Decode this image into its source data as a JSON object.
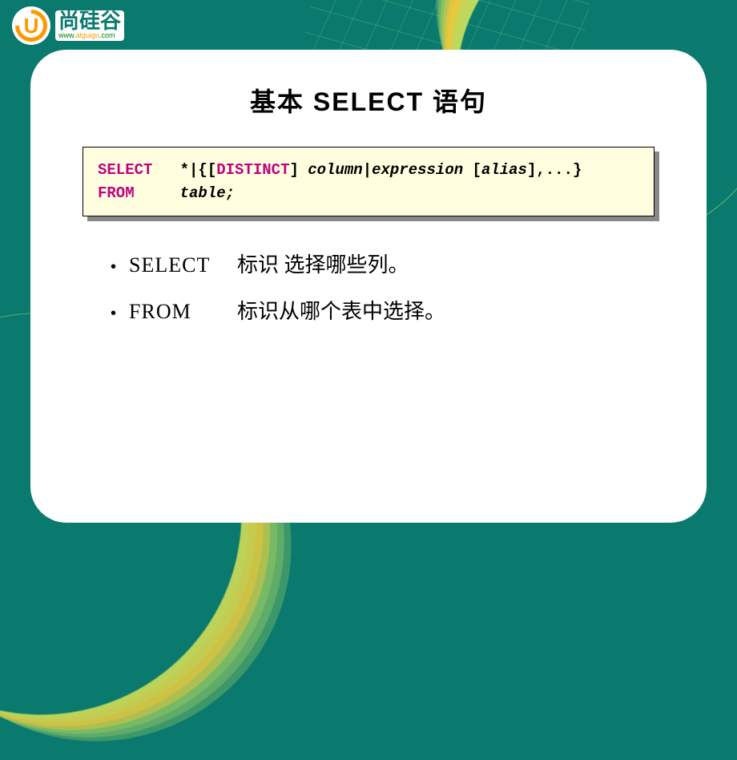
{
  "logo": {
    "icon_letter": "U",
    "brand_text": "尚硅谷",
    "url_www": "www.",
    "url_mid": "atguigu",
    "url_com": ".com"
  },
  "slide": {
    "title": "基本 SELECT 语句",
    "code": {
      "line1_select": "SELECT",
      "line1_star": "   *|{[",
      "line1_distinct": "DISTINCT",
      "line1_rest_a": "] ",
      "line1_column": "column",
      "line1_pipe": "|",
      "line1_expression": "expression",
      "line1_space": " [",
      "line1_alias": "alias",
      "line1_end": "],...}",
      "line2_from": "FROM",
      "line2_pad": "     ",
      "line2_table": "table;"
    },
    "bullets": [
      {
        "keyword": "SELECT",
        "description": "标识 选择哪些列。"
      },
      {
        "keyword": "FROM",
        "description": "标识从哪个表中选择。"
      }
    ]
  }
}
